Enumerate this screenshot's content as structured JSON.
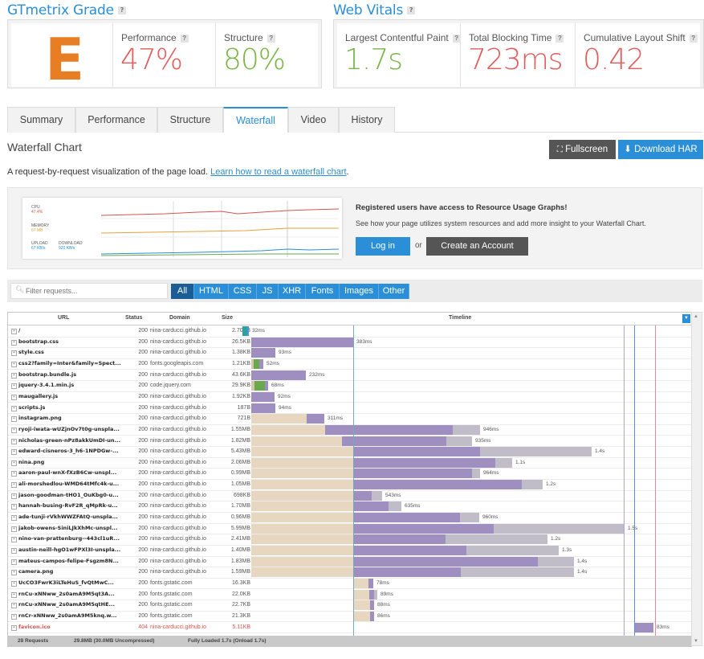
{
  "grade": {
    "title": "GTmetrix Grade",
    "letter": "E",
    "performance_label": "Performance",
    "performance_value": "47%",
    "structure_label": "Structure",
    "structure_value": "80%"
  },
  "vitals": {
    "title": "Web Vitals",
    "lcp_label": "Largest Contentful Paint",
    "lcp_value": "1.7s",
    "tbt_label": "Total Blocking Time",
    "tbt_value": "723ms",
    "cls_label": "Cumulative Layout Shift",
    "cls_value": "0.42"
  },
  "help_mark": "?",
  "colors": {
    "accent": "#2a8fd6",
    "bad": "#e35b5b",
    "good": "#79b644",
    "grade_e": "#e77e23"
  },
  "tabs": [
    "Summary",
    "Performance",
    "Structure",
    "Waterfall",
    "Video",
    "History"
  ],
  "active_tab": "Waterfall",
  "section": {
    "title": "Waterfall Chart",
    "fullscreen_label": "Fullscreen",
    "download_label": "Download HAR",
    "desc": "A request-by-request visualization of the page load.",
    "link": "Learn how to read a waterfall chart",
    "link_suffix": "."
  },
  "promo": {
    "cpu_label": "CPU",
    "cpu_value": "47.4%",
    "memory_label": "MEMORY",
    "memory_value": "67 MB",
    "upload_label": "UPLOAD",
    "upload_value": "67 KB/s",
    "download_label": "DOWNLOAD",
    "download_value": "920 KB/s",
    "heading": "Registered users have access to Resource Usage Graphs!",
    "text": "See how your page utilizes system resources and add more insight to your Waterfall Chart.",
    "login_label": "Log in",
    "or_label": "or",
    "create_label": "Create an Account"
  },
  "filter": {
    "placeholder": "Filter requests...",
    "buttons": [
      "All",
      "HTML",
      "CSS",
      "JS",
      "XHR",
      "Fonts",
      "Images",
      "Other"
    ],
    "active": "All"
  },
  "table": {
    "headers": {
      "url": "URL",
      "status": "Status",
      "domain": "Domain",
      "size": "Size",
      "timeline": "Timeline"
    },
    "rows": [
      {
        "url": "/",
        "status": "200",
        "domain": "nina-carducci.github.io",
        "size": "2.70KB",
        "time": "32ms"
      },
      {
        "url": "bootstrap.css",
        "status": "200",
        "domain": "nina-carducci.github.io",
        "size": "26.5KB",
        "time": "383ms"
      },
      {
        "url": "style.css",
        "status": "200",
        "domain": "nina-carducci.github.io",
        "size": "1.38KB",
        "time": "93ms"
      },
      {
        "url": "css2?family=Inter&family=Spect...",
        "status": "200",
        "domain": "fonts.googleapis.com",
        "size": "1.21KB",
        "time": "52ms"
      },
      {
        "url": "bootstrap.bundle.js",
        "status": "200",
        "domain": "nina-carducci.github.io",
        "size": "43.6KB",
        "time": "232ms"
      },
      {
        "url": "jquery-3.4.1.min.js",
        "status": "200",
        "domain": "code.jquery.com",
        "size": "29.9KB",
        "time": "68ms"
      },
      {
        "url": "maugallery.js",
        "status": "200",
        "domain": "nina-carducci.github.io",
        "size": "1.92KB",
        "time": "92ms"
      },
      {
        "url": "scripts.js",
        "status": "200",
        "domain": "nina-carducci.github.io",
        "size": "187B",
        "time": "94ms"
      },
      {
        "url": "instagram.png",
        "status": "200",
        "domain": "nina-carducci.github.io",
        "size": "721B",
        "time": "311ms"
      },
      {
        "url": "ryoji-iwata-wUZjnOv7t0g-unspla...",
        "status": "200",
        "domain": "nina-carducci.github.io",
        "size": "1.55MB",
        "time": "946ms"
      },
      {
        "url": "nicholas-green-nPz8akkUmDI-un...",
        "status": "200",
        "domain": "nina-carducci.github.io",
        "size": "1.82MB",
        "time": "935ms"
      },
      {
        "url": "edward-cisneros-3_h6-1NPDGw-...",
        "status": "200",
        "domain": "nina-carducci.github.io",
        "size": "5.43MB",
        "time": "1.4s"
      },
      {
        "url": "nina.png",
        "status": "200",
        "domain": "nina-carducci.github.io",
        "size": "2.06MB",
        "time": "1.1s"
      },
      {
        "url": "aaron-paul-wnX-fXzB6Cw-unspl...",
        "status": "200",
        "domain": "nina-carducci.github.io",
        "size": "0.99MB",
        "time": "964ms"
      },
      {
        "url": "ali-morshedlou-WMD64tMfc4k-u...",
        "status": "200",
        "domain": "nina-carducci.github.io",
        "size": "1.05MB",
        "time": "1.2s"
      },
      {
        "url": "jason-goodman-tHO1_OuKbg0-u...",
        "status": "200",
        "domain": "nina-carducci.github.io",
        "size": "698KB",
        "time": "543ms"
      },
      {
        "url": "hannah-busing-RvF2R_qMpRk-u...",
        "status": "200",
        "domain": "nina-carducci.github.io",
        "size": "1.70MB",
        "time": "635ms"
      },
      {
        "url": "ade-tunji-rVkhWWZFAtQ-unspla...",
        "status": "200",
        "domain": "nina-carducci.github.io",
        "size": "0.96MB",
        "time": "960ms"
      },
      {
        "url": "jakob-owens-SiniLJkXhMc-unspl...",
        "status": "200",
        "domain": "nina-carducci.github.io",
        "size": "5.99MB",
        "time": "1.5s"
      },
      {
        "url": "nino-van-prattenburg--443cl1uR...",
        "status": "200",
        "domain": "nina-carducci.github.io",
        "size": "2.41MB",
        "time": "1.2s"
      },
      {
        "url": "austin-neill-hgO1wFPXl3I-unspla...",
        "status": "200",
        "domain": "nina-carducci.github.io",
        "size": "1.40MB",
        "time": "1.3s"
      },
      {
        "url": "mateus-campos-felipe-Fsgzm8N...",
        "status": "200",
        "domain": "nina-carducci.github.io",
        "size": "1.83MB",
        "time": "1.4s"
      },
      {
        "url": "camera.png",
        "status": "200",
        "domain": "nina-carducci.github.io",
        "size": "1.59MB",
        "time": "1.4s"
      },
      {
        "url": "UcCO3FwrK3iLTeHuS_fvQtMwC...",
        "status": "200",
        "domain": "fonts.gstatic.com",
        "size": "16.3KB",
        "time": "78ms"
      },
      {
        "url": "rnCu-xNNww_2s0amA9M5qt3A...",
        "status": "200",
        "domain": "fonts.gstatic.com",
        "size": "22.0KB",
        "time": "89ms"
      },
      {
        "url": "rnCu-xNNww_2s0amA9M5qtHE...",
        "status": "200",
        "domain": "fonts.gstatic.com",
        "size": "22.7KB",
        "time": "88ms"
      },
      {
        "url": "rnCr-xNNww_2s0amA9M5knq.w...",
        "status": "200",
        "domain": "fonts.gstatic.com",
        "size": "21.3KB",
        "time": "86ms"
      },
      {
        "url": "favicon.ico",
        "status": "404",
        "domain": "nina-carducci.github.io",
        "size": "5.11KB",
        "time": "83ms"
      }
    ],
    "footer_requests": "28 Requests",
    "footer_size": "29.8MB (30.0MB Uncompressed)",
    "footer_loaded": "Fully Loaded 1.7s (Onload 1.7s)"
  }
}
